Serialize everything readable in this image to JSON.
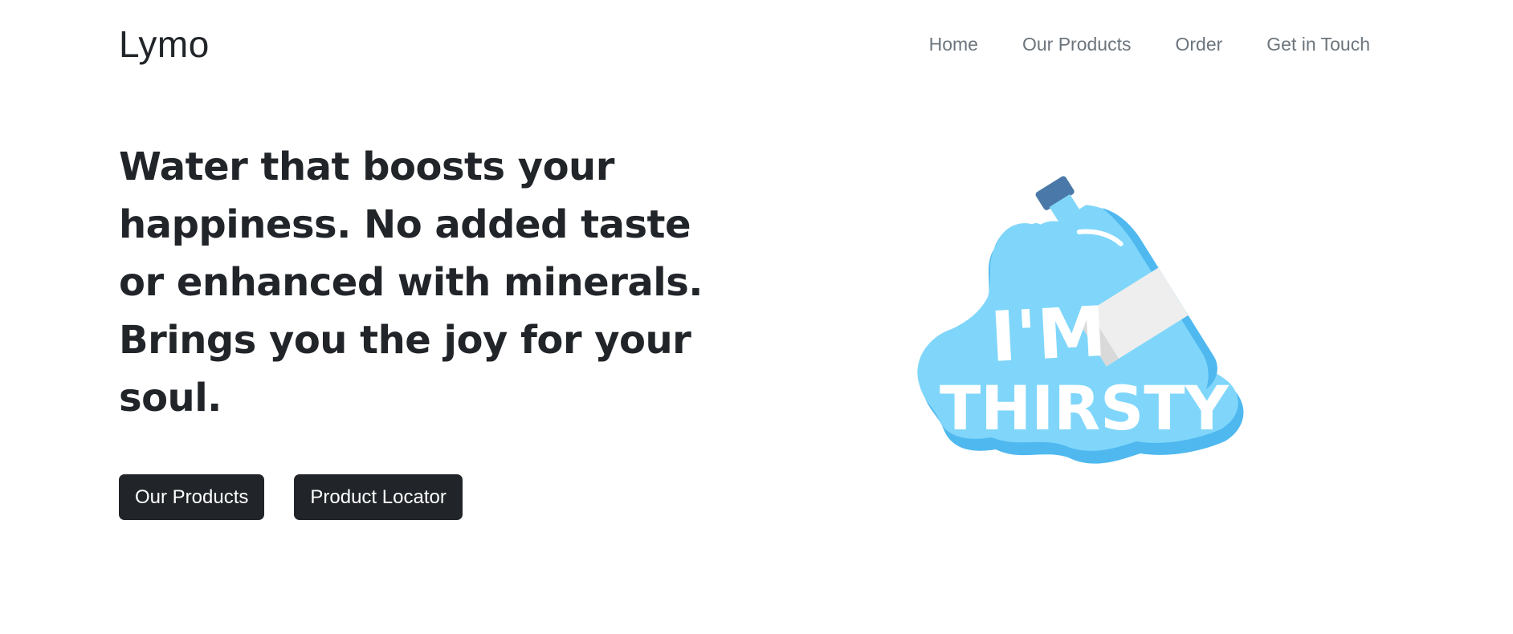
{
  "header": {
    "brand": "Lymo",
    "nav": [
      "Home",
      "Our Products",
      "Order",
      "Get in Touch"
    ]
  },
  "hero": {
    "headline": "Water that boosts your happiness. No added taste or enhanced with minerals. Brings you the joy for your soul.",
    "buttons": [
      "Our Products",
      "Product Locator"
    ]
  },
  "illustration": {
    "text_line1": "I'M",
    "text_line2": "THIRSTY",
    "icon": "water-bottle-splash-icon",
    "colors": {
      "water": "#7fd6fa",
      "water_shadow": "#4fb8ef",
      "cap": "#4a78a8",
      "label": "#eeeeee",
      "text": "#ffffff"
    }
  }
}
